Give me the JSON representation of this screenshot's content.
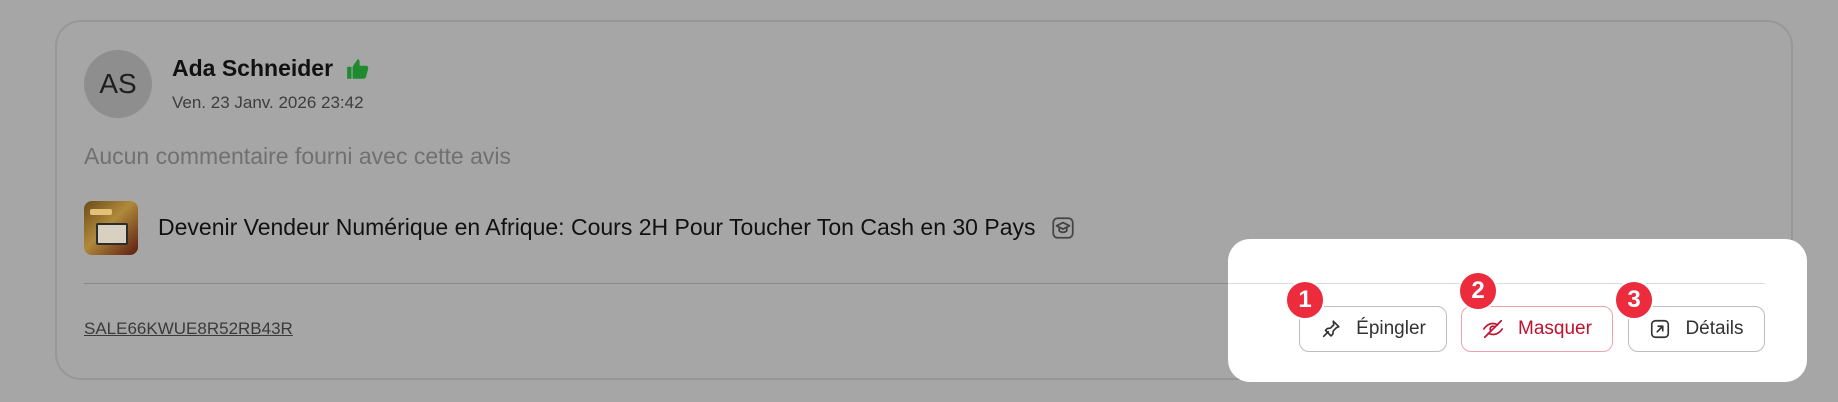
{
  "review": {
    "avatar_initials": "AS",
    "author_name": "Ada Schneider",
    "reaction_icon": "thumbs-up-icon",
    "reaction_color": "#1f8a2e",
    "date": "Ven. 23 Janv. 2026 23:42",
    "comment_placeholder": "Aucun commentaire fourni avec cette avis"
  },
  "product": {
    "title": "Devenir Vendeur Numérique en Afrique: Cours 2H Pour Toucher Ton Cash en 30 Pays",
    "type_icon": "graduation-cap-icon"
  },
  "sale": {
    "code": "SALE66KWUE8R52RB43R"
  },
  "actions": {
    "pin_label": "Épingler",
    "hide_label": "Masquer",
    "details_label": "Détails"
  },
  "badges": [
    "1",
    "2",
    "3"
  ],
  "colors": {
    "overlay": "#a6a6a6",
    "hide_accent": "#c0122c",
    "badge": "#ec2b3c"
  }
}
